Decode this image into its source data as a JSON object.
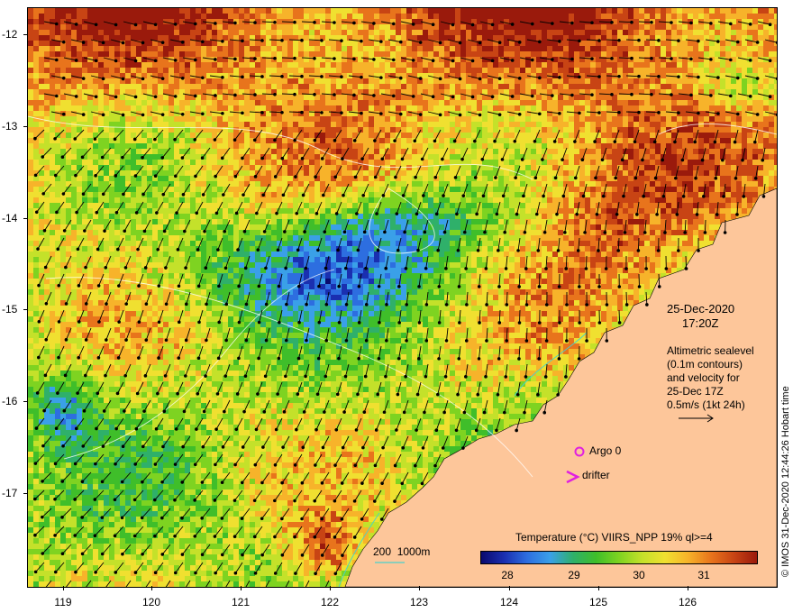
{
  "map": {
    "lat_ticks": [
      "-12",
      "-13",
      "-14",
      "-15",
      "-16",
      "-17"
    ],
    "lon_ticks": [
      "119",
      "120",
      "121",
      "122",
      "123",
      "124",
      "125",
      "126"
    ],
    "lat_range": [
      -17.95,
      -11.7
    ],
    "lon_range": [
      118.65,
      126.95
    ]
  },
  "info": {
    "date": "25-Dec-2020",
    "time": "17:20Z",
    "line1": "Altimetric sealevel",
    "line2": "(0.1m contours)",
    "line3": "and velocity for",
    "line4": "25-Dec 17Z",
    "line5": "0.5m/s (1kt 24h)"
  },
  "legend": {
    "argo_label": "Argo 0",
    "drifter_label": "drifter",
    "depth_label": "200  1000m",
    "depth_color": "#48d1cc"
  },
  "colorbar": {
    "title": "Temperature (°C) VIIRS_NPP 19% ql>=4",
    "ticks": [
      "28",
      "29",
      "30",
      "31"
    ],
    "range": [
      27.7,
      31.8
    ]
  },
  "credit": "© IMOS 31-Dec-2020 12:44:26 Hobart time",
  "colors": {
    "land": "#fdc69a",
    "marker": "#e020e0"
  }
}
